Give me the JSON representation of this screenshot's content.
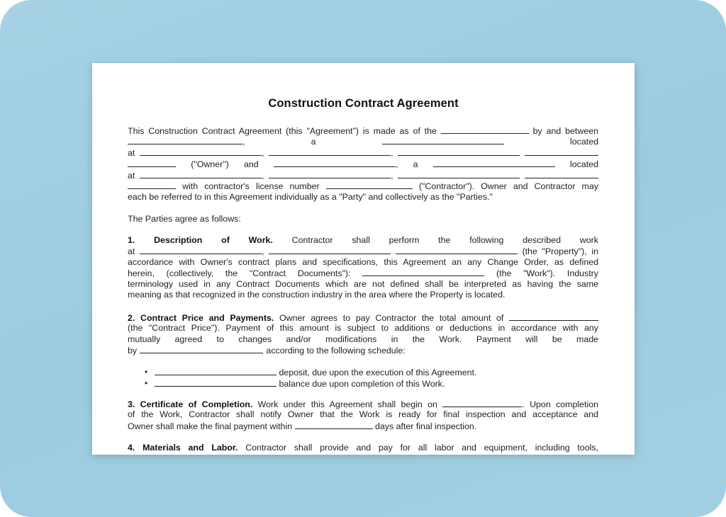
{
  "document": {
    "title": "Construction Contract Agreement",
    "intro": {
      "l1": {
        "a": "This Construction Contract Agreement (this \"Agreement\") is made as of the",
        "b": "by and between"
      },
      "l2": {
        "a": ",",
        "b": "a",
        "c": "located"
      },
      "l3": {
        "a": "at",
        "b": ",",
        "c": ","
      },
      "l4": {
        "a": "(\"Owner\")",
        "b": "and",
        "c": ",",
        "d": "a",
        "e": "located"
      },
      "l5": {
        "a": "at",
        "b": ",",
        "c": ","
      },
      "l6": {
        "a": "with contractor's license number",
        "b": "(\"Contractor\"). Owner and Contractor may"
      },
      "l7": "each be referred to in this Agreement individually as a \"Party\" and collectively as the \"Parties.\""
    },
    "agree": "The Parties agree as follows:",
    "s1": {
      "num": "1.",
      "h1": "Description",
      "h2": "of",
      "h3": "Work.",
      "l1": [
        "Contractor",
        "shall",
        "perform",
        "the",
        "following",
        "described",
        "work"
      ],
      "l2": {
        "a": "at",
        "b": ",",
        "c": "(the \"Property\"), in"
      },
      "l3": "accordance with Owner's contract plans and specifications, this Agreement an any Change Order, as defined",
      "l4": {
        "a": "herein, (collectively, the \"Contract Documents\"):",
        "b": "(the \"Work\"). Industry"
      },
      "l5": "terminology used in any Contract Documents which are not defined shall be interpreted as having the same",
      "l6": "meaning as that recognized in the construction industry in the area where the Property is located."
    },
    "s2": {
      "heading": "2. Contract Price and Payments.",
      "l1": "Owner agrees to pay Contractor the total amount of",
      "l2": "(the \"Contract Price\"). Payment of this amount is subject to additions or deductions in accordance with any",
      "l3": "mutually agreed to changes and/or modifications in the Work. Payment will be made",
      "l4": {
        "a": "by",
        "b": ", according to the following schedule:"
      },
      "bullets": [
        "deposit, due upon the execution of this Agreement.",
        "balance due upon completion of this Work."
      ]
    },
    "s3": {
      "heading": "3. Certificate of Completion.",
      "l1": {
        "a": "Work under this Agreement shall begin on",
        "b": ". Upon completion"
      },
      "l2": "of the Work, Contractor shall notify Owner that the Work is ready for final inspection and acceptance and",
      "l3": {
        "a": "Owner shall make the final payment within",
        "b": "days after final inspection."
      }
    },
    "s4": {
      "heading": "4. Materials and Labor.",
      "l1": "Contractor shall provide and pay for all labor and equipment, including tools,"
    }
  }
}
